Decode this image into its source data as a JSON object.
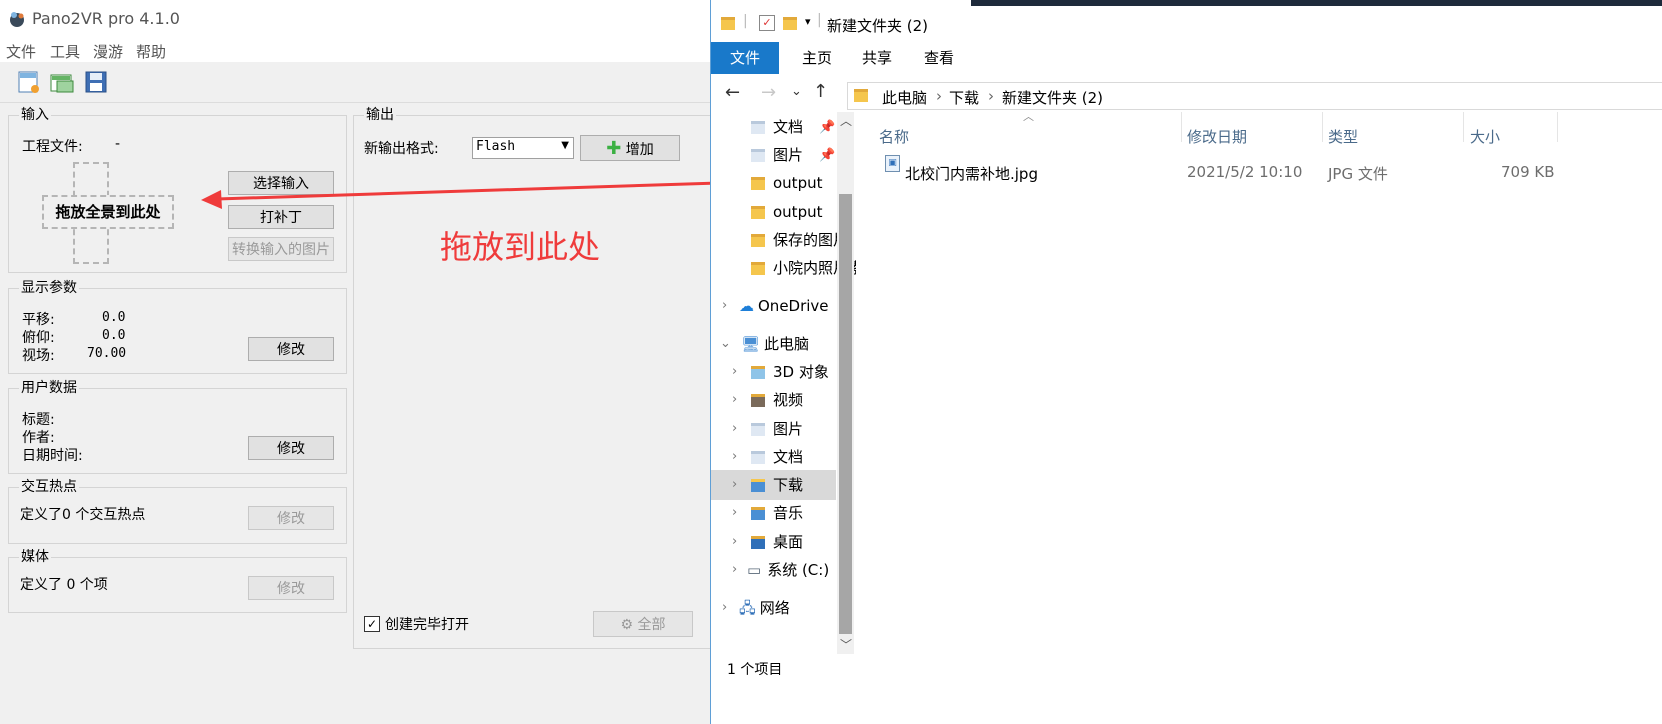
{
  "pano2vr": {
    "title": "Pano2VR pro 4.1.0",
    "menu": [
      "文件",
      "工具",
      "漫游",
      "帮助"
    ],
    "toolbar": {
      "new_icon": "new-project-icon",
      "open_icon": "open-project-icon",
      "save_icon": "save-icon"
    },
    "input": {
      "title": "输入",
      "project_label": "工程文件:",
      "project_value": "-",
      "drop_text": "拖放全景到此处",
      "select_btn": "选择输入",
      "patch_btn": "打补丁",
      "convert_btn": "转换输入的图片"
    },
    "display": {
      "title": "显示参数",
      "pan_label": "平移:",
      "pan_value": "0.0",
      "tilt_label": "俯仰:",
      "tilt_value": "0.0",
      "fov_label": "视场:",
      "fov_value": "70.00",
      "modify_btn": "修改"
    },
    "userdata": {
      "title": "用户数据",
      "title_label": "标题:",
      "author_label": "作者:",
      "datetime_label": "日期时间:",
      "modify_btn": "修改"
    },
    "hotspots": {
      "title": "交互热点",
      "text": "定义了0 个交互热点",
      "modify_btn": "修改"
    },
    "media": {
      "title": "媒体",
      "text": "定义了 0 个项",
      "modify_btn": "修改"
    },
    "output": {
      "title": "输出",
      "format_label": "新输出格式:",
      "format_value": "Flash",
      "add_btn": "增加",
      "open_after_label": "创建完毕打开",
      "all_btn": "全部"
    }
  },
  "annotation": {
    "text": "拖放到此处",
    "color": "#ef3b3b"
  },
  "explorer": {
    "title": "新建文件夹 (2)",
    "ribbon_tabs": [
      "文件",
      "主页",
      "共享",
      "查看"
    ],
    "breadcrumb": [
      "此电脑",
      "下载",
      "新建文件夹 (2)"
    ],
    "nav_quick": [
      "文档",
      "图片",
      "output",
      "output",
      "保存的图片",
      "小院内照片素材"
    ],
    "nav_onedrive": "OneDrive",
    "nav_thispc": "此电脑",
    "nav_pc_items": [
      "3D 对象",
      "视频",
      "图片",
      "文档",
      "下载",
      "音乐",
      "桌面",
      "系统 (C:)"
    ],
    "nav_network": "网络",
    "columns": [
      "名称",
      "修改日期",
      "类型",
      "大小"
    ],
    "file": {
      "name": "北校门内需补地.jpg",
      "date": "2021/5/2 10:10",
      "type": "JPG 文件",
      "size": "709 KB"
    },
    "status": "1 个项目"
  }
}
